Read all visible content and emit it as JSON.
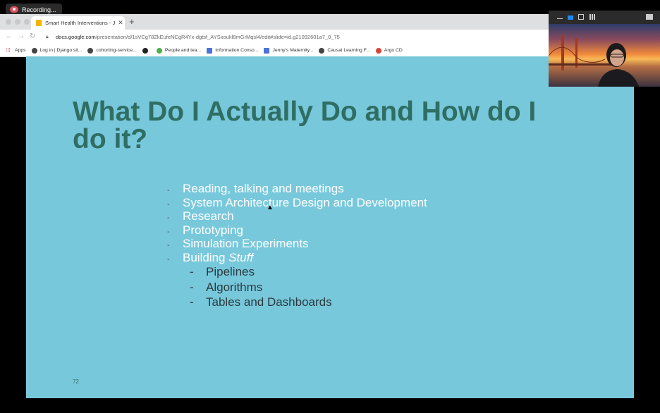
{
  "recording": {
    "label": "Recording..."
  },
  "browser": {
    "tab": {
      "title": "Smart Health Interventions - J"
    },
    "address": {
      "host": "docs.google.com",
      "path": "/presentation/d/1sVCg78ZkEufeNCgR4Yx-dgtsf_AYSxoukl8mGrMqsl4/edit#slide=id.g21092601a7_0_75"
    },
    "bookmarks": [
      {
        "label": "Apps",
        "icon": "apps-grid-icon"
      },
      {
        "label": "Log in | Django sit...",
        "icon": "globe-icon"
      },
      {
        "label": "cohorting-service...",
        "icon": "globe-icon"
      },
      {
        "label": "",
        "icon": "c-logo-icon"
      },
      {
        "label": "People and tea...",
        "icon": "people-icon"
      },
      {
        "label": "Information Conso...",
        "icon": "docs-icon"
      },
      {
        "label": "Jenny's Maternity...",
        "icon": "docs-icon"
      },
      {
        "label": "Causal Learning F...",
        "icon": "globe-icon"
      },
      {
        "label": "Argo CD",
        "icon": "argo-icon"
      }
    ]
  },
  "slide": {
    "title": "What Do I Actually Do and How do I do it?",
    "bullets": [
      {
        "dash": "-",
        "text": "Reading, talking and meetings"
      },
      {
        "dash": "-",
        "text": "System Architecture Design and Development"
      },
      {
        "dash": "-",
        "text": "Research"
      },
      {
        "dash": "-",
        "text": "Prototyping"
      },
      {
        "dash": "-",
        "text": "Simulation Experiments"
      },
      {
        "dash": "-",
        "text": "Building ",
        "emphasis": "Stuff"
      }
    ],
    "sub_bullets": [
      {
        "dash": "-",
        "text": "Pipelines"
      },
      {
        "dash": "-",
        "text": "Algorithms"
      },
      {
        "dash": "-",
        "text": "Tables and Dashboards"
      }
    ],
    "page_number": "72"
  },
  "colors": {
    "slide_background": "#78c8dc",
    "title_color": "#2f6e63",
    "bullet_color": "#ffffff",
    "sub_bullet_color": "#2b3b3d"
  }
}
